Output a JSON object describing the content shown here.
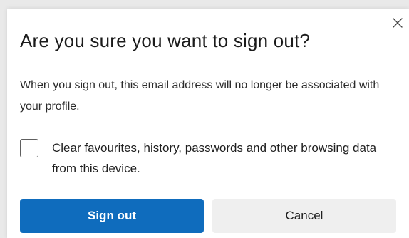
{
  "dialog": {
    "title": "Are you sure you want to sign out?",
    "description": "When you sign out, this email address will no longer be associated with your profile.",
    "close_icon": "close-icon",
    "checkbox": {
      "label": "Clear favourites, history, passwords and other browsing data from this device.",
      "checked": false
    },
    "buttons": {
      "primary_label": "Sign out",
      "secondary_label": "Cancel"
    }
  },
  "colors": {
    "primary": "#0f6cbd",
    "secondary_bg": "#efefef",
    "text": "#1b1b1b"
  }
}
